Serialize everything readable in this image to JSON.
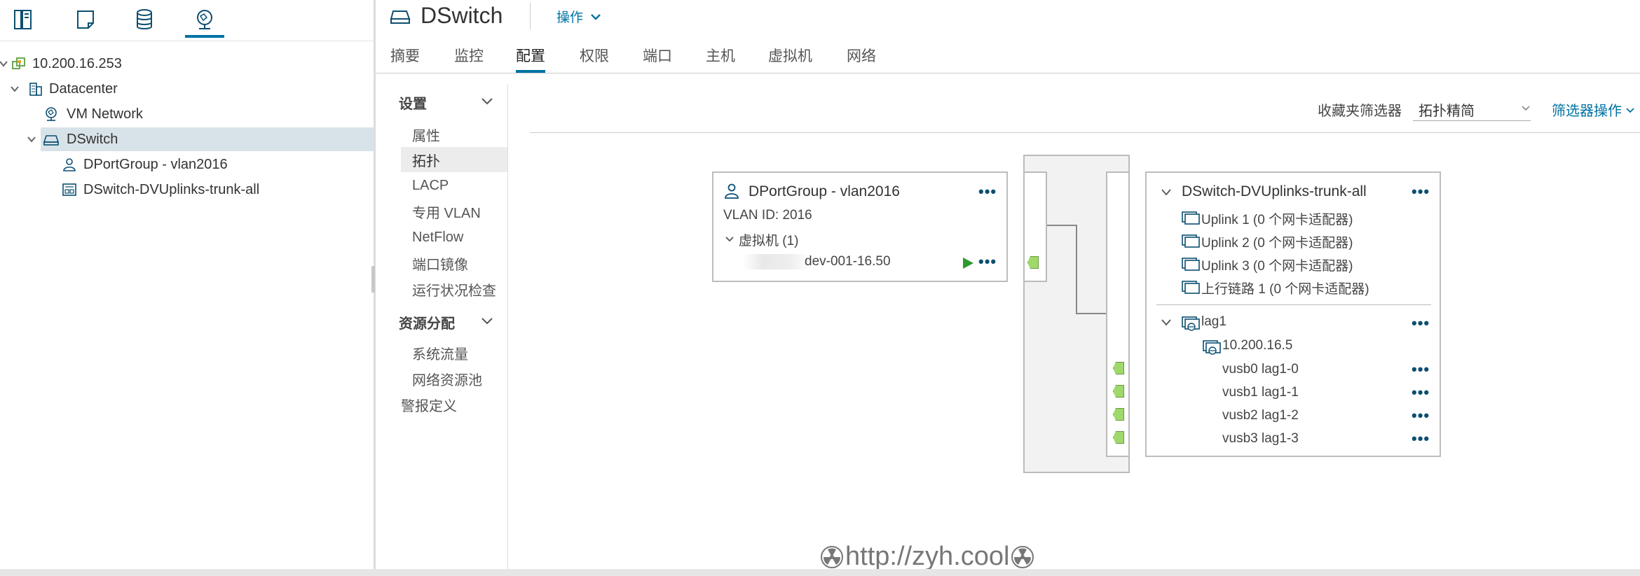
{
  "navigator": {
    "tabs": [
      {
        "icon": "hosts-clusters-icon"
      },
      {
        "icon": "vms-templates-icon"
      },
      {
        "icon": "storage-icon"
      },
      {
        "icon": "networking-icon"
      }
    ],
    "tree": [
      {
        "label": "10.200.16.253",
        "icon": "vcenter-icon"
      },
      {
        "label": "Datacenter",
        "icon": "datacenter-icon"
      },
      {
        "label": "VM Network",
        "icon": "network-icon"
      },
      {
        "label": "DSwitch",
        "icon": "dswitch-icon"
      },
      {
        "label": "DPortGroup - vlan2016",
        "icon": "portgroup-icon"
      },
      {
        "label": "DSwitch-DVUplinks-trunk-all",
        "icon": "uplink-portgroup-icon"
      }
    ]
  },
  "header": {
    "title": "DSwitch",
    "actions_label": "操作",
    "tabs": [
      "摘要",
      "监控",
      "配置",
      "权限",
      "端口",
      "主机",
      "虚拟机",
      "网络"
    ],
    "active_tab": "配置"
  },
  "side_menu": {
    "sections": [
      {
        "title": "设置",
        "items": [
          "属性",
          "拓扑",
          "LACP",
          "专用 VLAN",
          "NetFlow",
          "端口镜像",
          "运行状况检查"
        ]
      },
      {
        "title": "资源分配",
        "items": [
          "系统流量",
          "网络资源池"
        ]
      }
    ],
    "extra_item": "警报定义",
    "active_item": "拓扑"
  },
  "filter_bar": {
    "label": "收藏夹筛选器",
    "selected": "拓扑精简",
    "actions_label": "筛选器操作"
  },
  "portgroup_card": {
    "title": "DPortGroup - vlan2016",
    "vlan": "VLAN ID: 2016",
    "vms_label": "虚拟机 (1)",
    "vm_name": "dev-001-16.50"
  },
  "uplinks_card": {
    "title": "DSwitch-DVUplinks-trunk-all",
    "uplinks": [
      "Uplink 1 (0 个网卡适配器)",
      "Uplink 2 (0 个网卡适配器)",
      "Uplink 3 (0 个网卡适配器)",
      "上行链路 1 (0 个网卡适配器)"
    ],
    "lag": {
      "name": "lag1",
      "host": "10.200.16.5",
      "ports": [
        "vusb0 lag1-0",
        "vusb1 lag1-1",
        "vusb2 lag1-2",
        "vusb3 lag1-3"
      ]
    }
  },
  "watermark": "http://zyh.cool",
  "colors": {
    "accent": "#0072a3",
    "selected_row": "#d8e3e9",
    "port_green": "#9fd86b"
  }
}
